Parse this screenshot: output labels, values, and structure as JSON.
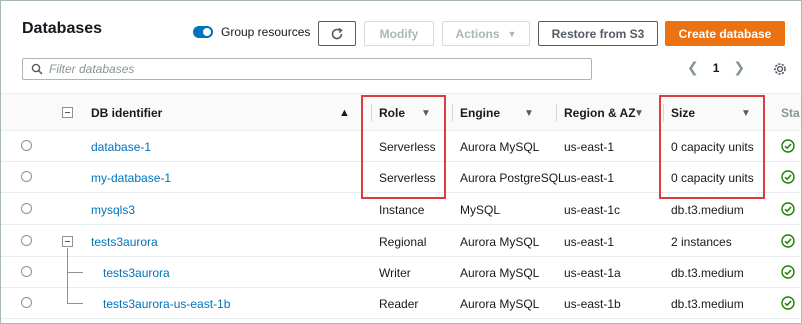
{
  "header": {
    "title": "Databases",
    "group_resources_label": "Group resources",
    "buttons": {
      "modify": "Modify",
      "actions": "Actions",
      "restore": "Restore from S3",
      "create": "Create database"
    }
  },
  "search": {
    "placeholder": "Filter databases",
    "value": ""
  },
  "pagination": {
    "current_page": "1"
  },
  "columns": {
    "db_identifier": "DB identifier",
    "role": "Role",
    "engine": "Engine",
    "region": "Region & AZ",
    "size": "Size",
    "status": "Sta"
  },
  "rows": [
    {
      "id": "database-1",
      "role": "Serverless",
      "engine": "Aurora MySQL",
      "region": "us-east-1",
      "size": "0 capacity units"
    },
    {
      "id": "my-database-1",
      "role": "Serverless",
      "engine": "Aurora PostgreSQL",
      "region": "us-east-1",
      "size": "0 capacity units"
    },
    {
      "id": "mysqls3",
      "role": "Instance",
      "engine": "MySQL",
      "region": "us-east-1c",
      "size": "db.t3.medium"
    },
    {
      "id": "tests3aurora",
      "role": "Regional",
      "engine": "Aurora MySQL",
      "region": "us-east-1",
      "size": "2 instances"
    },
    {
      "id": "tests3aurora",
      "role": "Writer",
      "engine": "Aurora MySQL",
      "region": "us-east-1a",
      "size": "db.t3.medium"
    },
    {
      "id": "tests3aurora-us-east-1b",
      "role": "Reader",
      "engine": "Aurora MySQL",
      "region": "us-east-1b",
      "size": "db.t3.medium"
    }
  ],
  "colors": {
    "link": "#0073bb",
    "primary_button": "#ec7211",
    "toggle_on": "#0073bb",
    "status_ok": "#1d8102",
    "highlight": "#dd3c3c"
  },
  "icons": {
    "refresh": "refresh-icon",
    "search": "search-icon",
    "settings": "gear-icon",
    "status": "check-circle-icon"
  }
}
